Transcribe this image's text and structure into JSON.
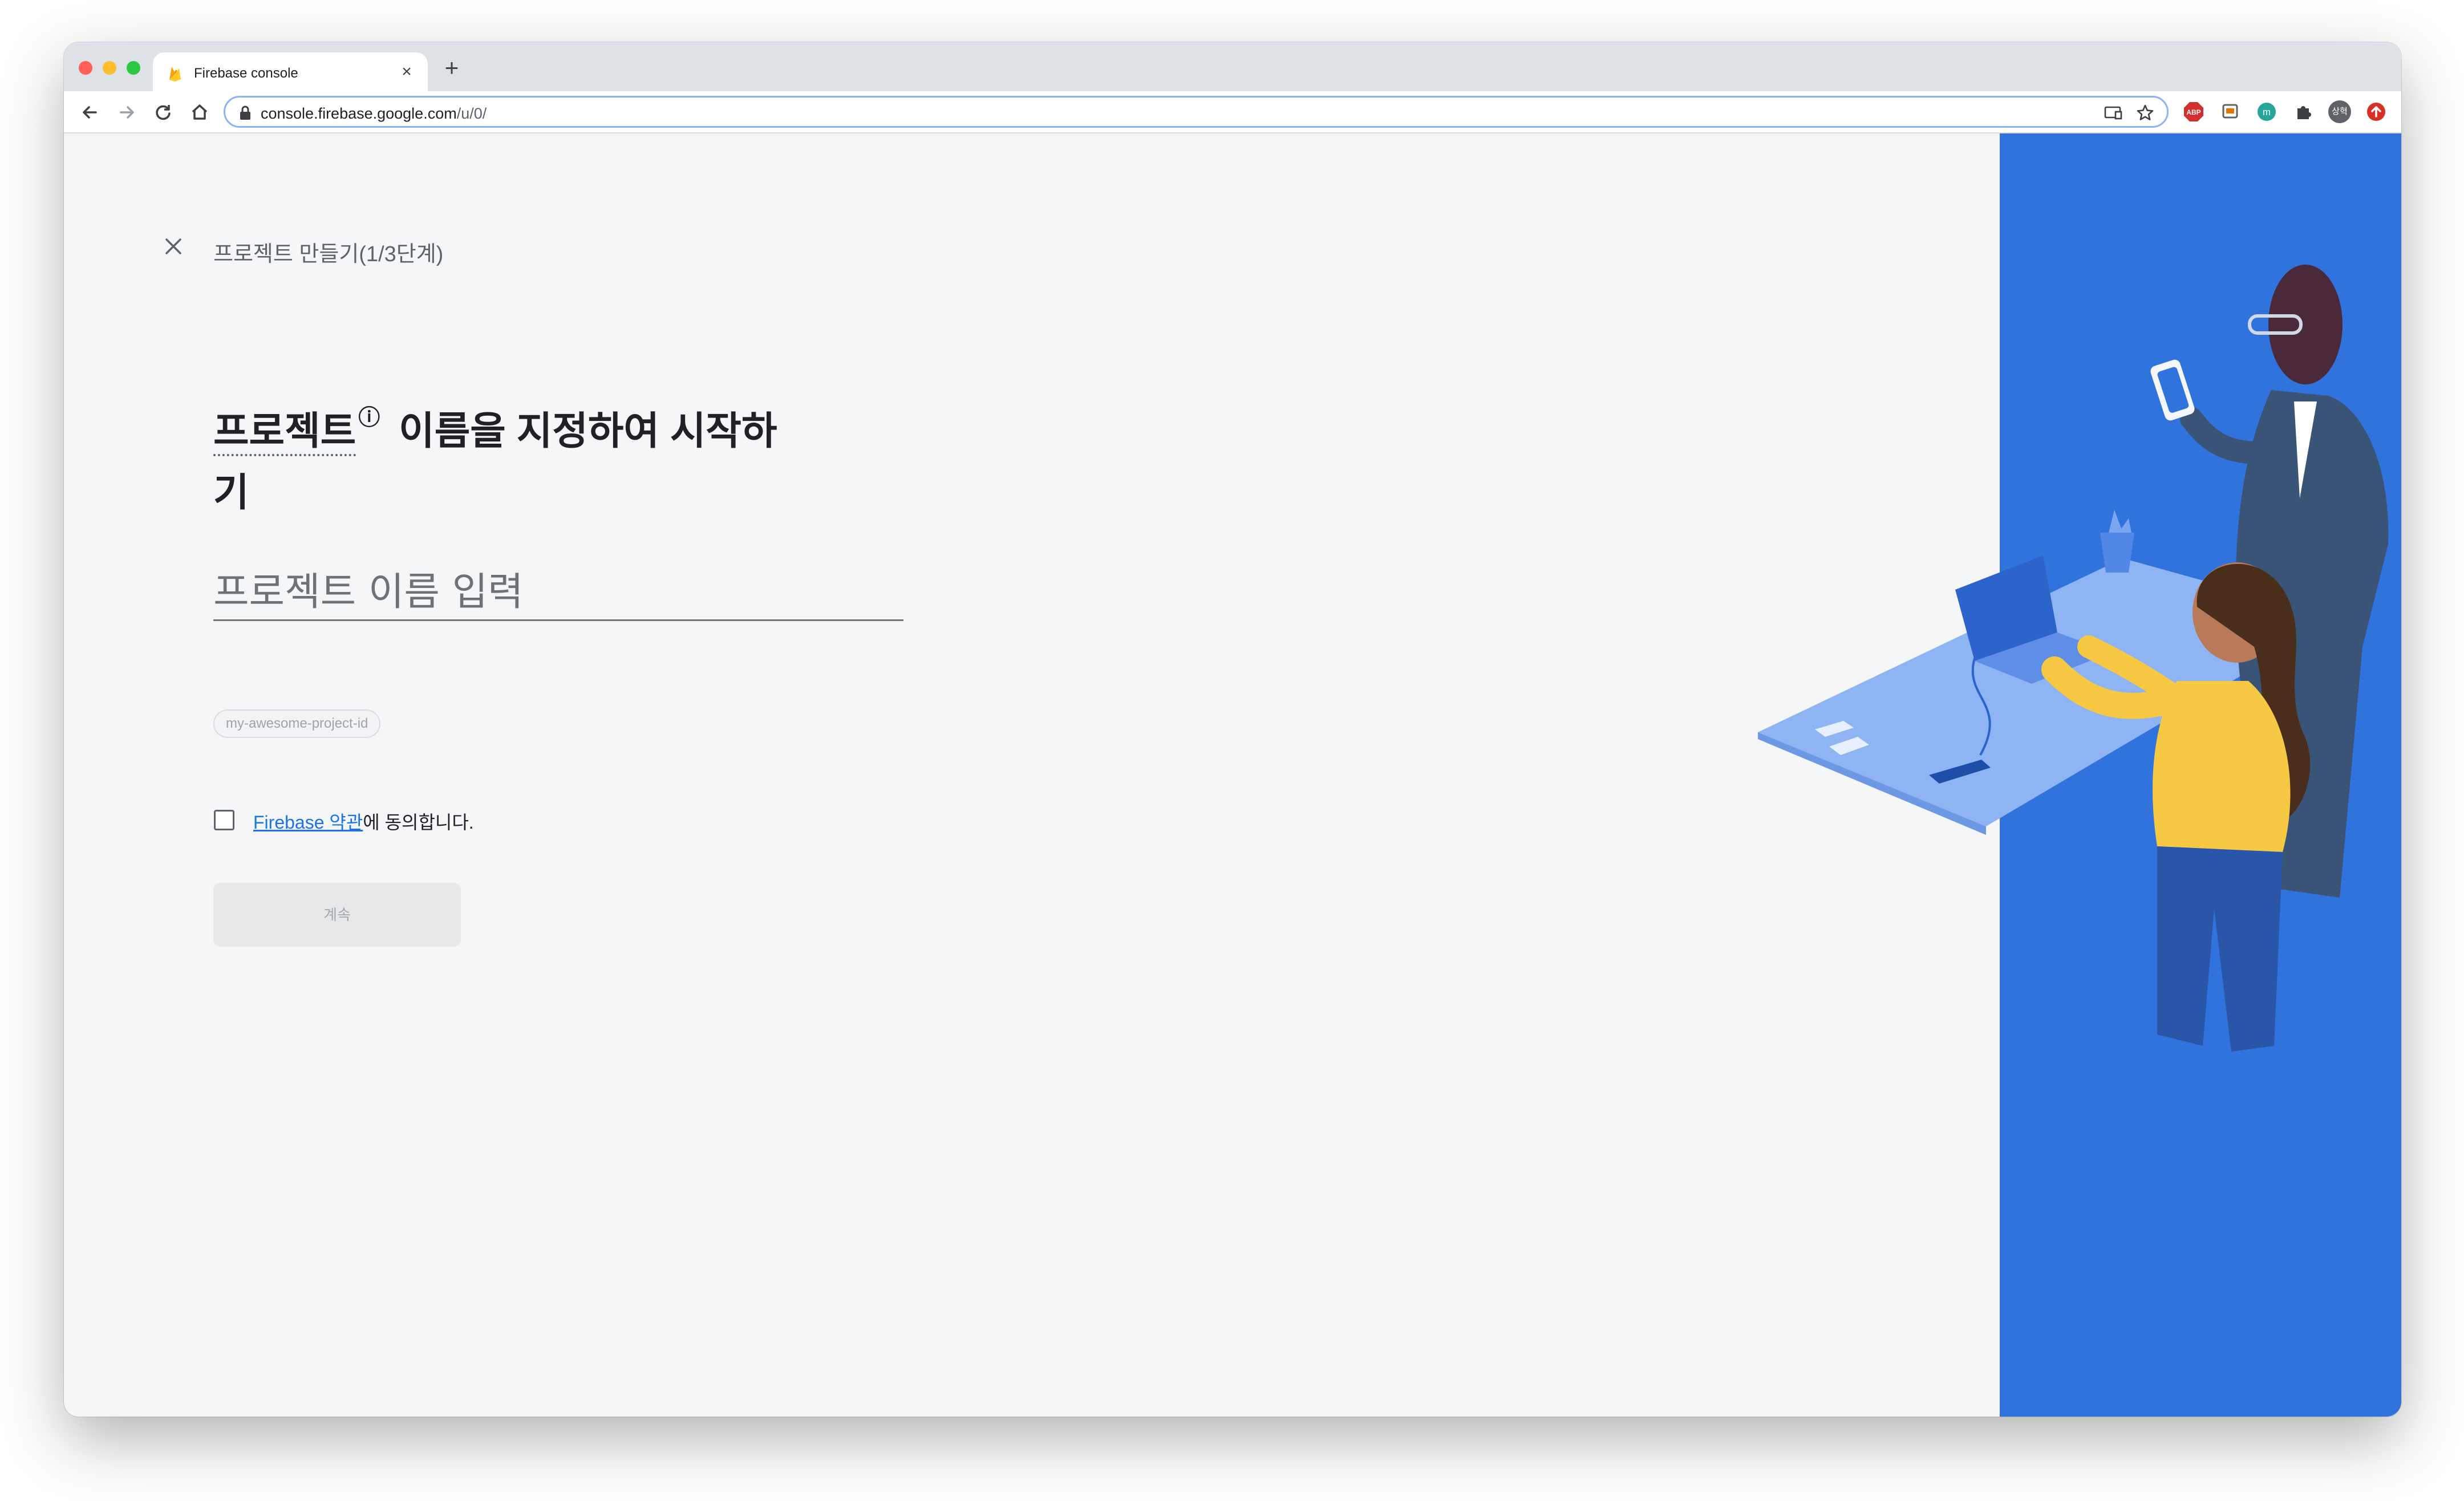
{
  "browser": {
    "tab_title": "Firebase console",
    "url_host": "console.firebase.google.com",
    "url_path": "/u/0/",
    "profile_initials": "상혁"
  },
  "page": {
    "step_title": "프로젝트 만들기(1/3단계)",
    "heading_term": "프로젝트",
    "heading_help": "?",
    "heading_rest": " 이름을 지정하여 시작하기",
    "name_placeholder": "프로젝트 이름 입력",
    "name_value": "",
    "project_id": "my-awesome-project-id",
    "terms_link": "Firebase 약관",
    "terms_suffix": "에 동의합니다.",
    "terms_checked": false,
    "continue_label": "계속"
  },
  "colors": {
    "accent": "#1a73e8",
    "illustration_bg": "#3173dc",
    "content_bg": "#f5f6f7"
  },
  "icons": {
    "close": "close-icon",
    "help": "help-icon",
    "lock": "lock-icon",
    "back": "back-arrow-icon",
    "forward": "forward-arrow-icon",
    "reload": "reload-icon",
    "home": "home-icon"
  }
}
